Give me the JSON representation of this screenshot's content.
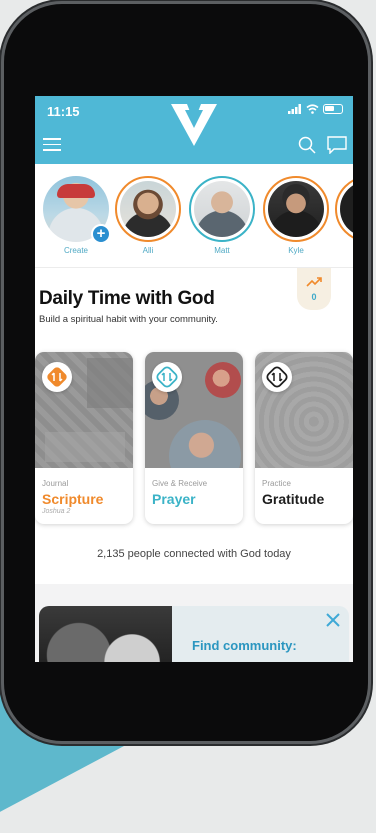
{
  "status": {
    "time": "11:15"
  },
  "colors": {
    "header": "#4fb8d6",
    "orange_accent": "#f08a2c",
    "teal_accent": "#3bb3c7",
    "link_blue": "#2b96c0"
  },
  "header": {
    "icons": [
      "menu-icon",
      "app-logo",
      "search-icon",
      "chat-icon"
    ]
  },
  "stories": [
    {
      "label": "Create"
    },
    {
      "label": "Alli"
    },
    {
      "label": "Matt"
    },
    {
      "label": "Kyle"
    }
  ],
  "daily": {
    "title": "Daily Time with God",
    "subtitle": "Build a spiritual habit with your community.",
    "streak_count": "0",
    "cards": [
      {
        "kicker": "Journal",
        "title": "Scripture",
        "reference": "Joshua 2",
        "color": "#f08a2c"
      },
      {
        "kicker": "Give & Receive",
        "title": "Prayer",
        "color": "#3bb3c7"
      },
      {
        "kicker": "Practice",
        "title": "Gratitude",
        "color": "#1e1e1e"
      }
    ],
    "connected_text": "2,135 people connected with God today"
  },
  "community": {
    "title": "Find community:"
  }
}
